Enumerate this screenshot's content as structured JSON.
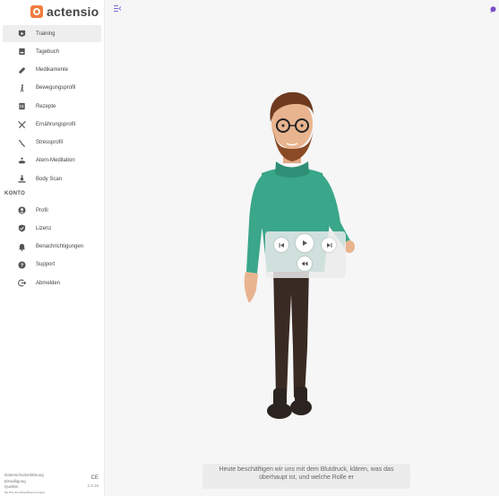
{
  "app": {
    "logo_text": "actensio",
    "brand_color": "#f07c3e"
  },
  "nav": {
    "items": [
      {
        "label": "Training",
        "icon": "play-icon",
        "active": true
      },
      {
        "label": "Tagebuch",
        "icon": "diary-icon"
      },
      {
        "label": "Medikamente",
        "icon": "pill-icon"
      },
      {
        "label": "Bewegungsprofil",
        "icon": "walking-icon"
      },
      {
        "label": "Rezepte",
        "icon": "recipe-icon"
      },
      {
        "label": "Ernährungsprofil",
        "icon": "cutlery-icon"
      },
      {
        "label": "Stressprofil",
        "icon": "stress-icon"
      },
      {
        "label": "Atem-Meditation",
        "icon": "meditation-icon"
      },
      {
        "label": "Body Scan",
        "icon": "body-scan-icon"
      }
    ]
  },
  "konto": {
    "heading": "KONTO",
    "items": [
      {
        "label": "Profil",
        "icon": "profile-icon"
      },
      {
        "label": "Lizenz",
        "icon": "license-icon"
      },
      {
        "label": "Benachrichtigungen",
        "icon": "bell-icon"
      },
      {
        "label": "Support",
        "icon": "help-icon"
      },
      {
        "label": "Abmelden",
        "icon": "logout-icon"
      }
    ]
  },
  "footer": {
    "links": [
      "Datenschutzerklärung",
      "Einwilligung",
      "Quellen",
      "Nutzungsbedingungen"
    ],
    "ce_mark": "CE",
    "version": "1.0.16"
  },
  "player": {
    "controls": [
      "previous-icon",
      "play-icon",
      "next-icon",
      "rewind-icon"
    ]
  },
  "caption": {
    "line1": "Heute beschäftigen wir uns mit dem Blutdruck, klären, was das",
    "line2": "überhaupt ist, und welche Rolle er"
  }
}
